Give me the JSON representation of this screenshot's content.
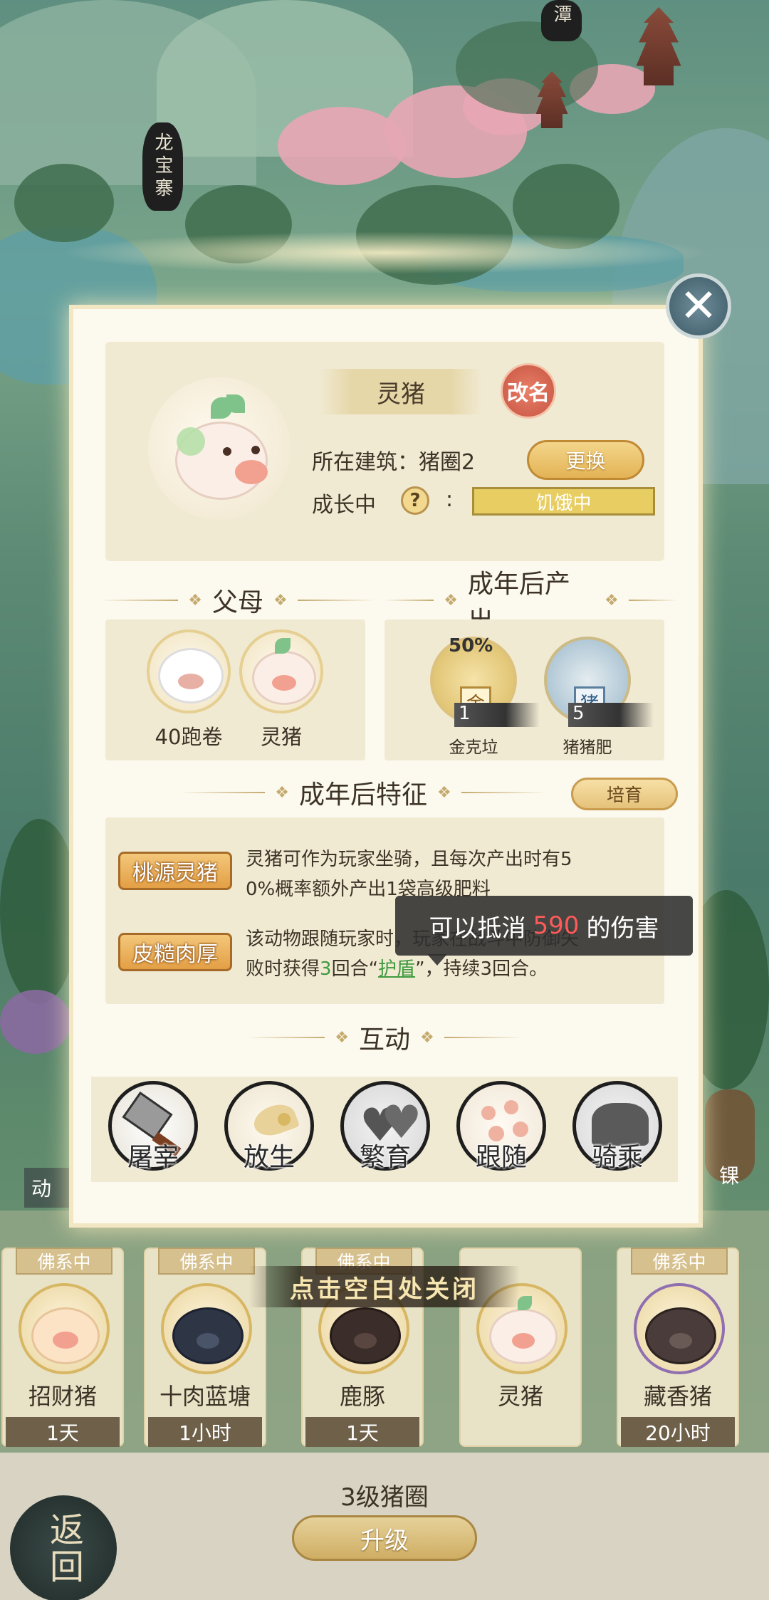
{
  "map": {
    "label_left": "龙宝寨",
    "label_top": "潭"
  },
  "pet": {
    "name": "灵猪",
    "rename_label": "改名",
    "building_label": "所在建筑：猪圈2",
    "change_label": "更换",
    "growth_label": "成长中",
    "help_symbol": "?",
    "colon": ":",
    "status": "饥饿中"
  },
  "parents": {
    "title": "父母",
    "items": [
      {
        "name": "40跑卷"
      },
      {
        "name": "灵猪"
      }
    ]
  },
  "adult_output": {
    "title": "成年后产出",
    "items": [
      {
        "name": "金克垃",
        "count": "1",
        "tag": "金",
        "chance": "50%"
      },
      {
        "name": "猪猪肥",
        "count": "5",
        "tag": "猪"
      }
    ]
  },
  "traits": {
    "title": "成年后特征",
    "cultivate_label": "培育",
    "items": [
      {
        "badge": "桃源灵猪",
        "line1": "灵猪可作为玩家坐骑，且每次产出时有5",
        "line2": "0%概率额外产出1袋高级肥料"
      },
      {
        "badge": "皮糙肉厚",
        "line1": "该动物跟随玩家时，玩家在战斗中防御失",
        "line2_pre": "败时获得",
        "line2_num": "3",
        "line2_mid": "回合“",
        "line2_link": "护盾",
        "line2_post": "”，持续3回合。"
      }
    ]
  },
  "tooltip": {
    "pre": "可以抵消",
    "num": "590",
    "post": "的伤害"
  },
  "interact": {
    "title": "互动",
    "actions": [
      {
        "label": "屠宰",
        "icon": "cleaver-icon"
      },
      {
        "label": "放生",
        "icon": "bird-icon"
      },
      {
        "label": "繁育",
        "icon": "hearts-icon"
      },
      {
        "label": "跟随",
        "icon": "paw-icon"
      },
      {
        "label": "骑乘",
        "icon": "saddle-icon"
      }
    ]
  },
  "close_hint": "点击空白处关闭",
  "pen": {
    "slots": [
      {
        "badge": "佛系中",
        "name": "招财猪",
        "time": "1天"
      },
      {
        "badge": "佛系中",
        "name": "十肉蓝塘",
        "time": "1小时"
      },
      {
        "badge": "佛系中",
        "name": "鹿豚",
        "time": "1天"
      },
      {
        "badge": "",
        "name": "灵猪",
        "time": ""
      },
      {
        "badge": "佛系中",
        "name": "藏香猪",
        "time": "20小时"
      }
    ],
    "level_label": "3级猪圈",
    "upgrade_label": "升级"
  },
  "back_label": "返回",
  "side_tab_label": "动",
  "side_right_label": "锞",
  "close_symbol": "✕"
}
